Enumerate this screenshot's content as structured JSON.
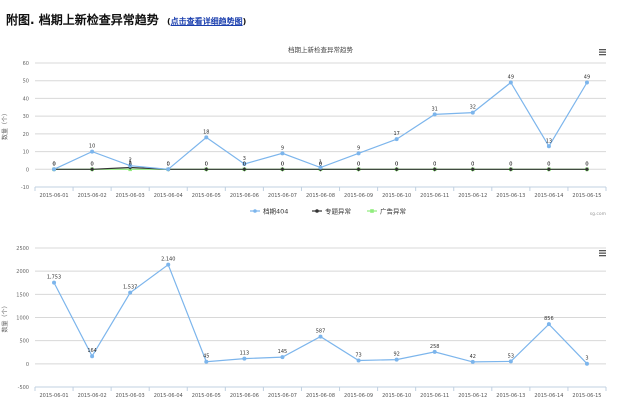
{
  "page": {
    "title": "附图. 档期上新检查异常趋势",
    "subtitle_prefix": "(",
    "subtitle_link": "点击查看详细趋势图",
    "subtitle_suffix": ")"
  },
  "chart_data": [
    {
      "type": "line",
      "title": "档期上新检查异常趋势",
      "ylabel": "数量（个）",
      "xlabel": "",
      "ylim": [
        -10,
        60
      ],
      "yticks": [
        -10,
        0,
        10,
        20,
        30,
        40,
        50,
        60
      ],
      "grid": true,
      "legend_position": "bottom-center",
      "categories": [
        "2015-06-01",
        "2015-06-02",
        "2015-06-03",
        "2015-06-04",
        "2015-06-05",
        "2015-06-06",
        "2015-06-07",
        "2015-06-08",
        "2015-06-09",
        "2015-06-10",
        "2015-06-11",
        "2015-06-12",
        "2015-06-13",
        "2015-06-14",
        "2015-06-15"
      ],
      "series": [
        {
          "name": "档期404",
          "color": "#7cb5ec",
          "values": [
            0,
            10,
            2,
            0,
            18,
            3,
            9,
            1,
            9,
            17,
            31,
            32,
            49,
            13,
            49
          ]
        },
        {
          "name": "专题异常",
          "color": "#333333",
          "values": [
            0,
            0,
            1,
            0,
            0,
            0,
            0,
            0,
            0,
            0,
            0,
            0,
            0,
            0,
            0
          ]
        },
        {
          "name": "广告异常",
          "color": "#90ed7d",
          "values": [
            0,
            0,
            0,
            0,
            0,
            0,
            0,
            0,
            0,
            0,
            0,
            0,
            0,
            0,
            0
          ]
        }
      ],
      "data_labels": [
        "0",
        "10",
        "2",
        "0",
        "18",
        "3",
        "9",
        "1",
        "9",
        "17",
        "31",
        "32",
        "49",
        "13",
        "49"
      ],
      "credit": "sg.com"
    },
    {
      "type": "line",
      "title": "",
      "ylabel": "数量（个）",
      "xlabel": "",
      "ylim": [
        -500,
        2500
      ],
      "yticks": [
        -500,
        0,
        500,
        1000,
        1500,
        2000,
        2500
      ],
      "grid": true,
      "categories": [
        "2015-06-01",
        "2015-06-02",
        "2015-06-03",
        "2015-06-04",
        "2015-06-05",
        "2015-06-06",
        "2015-06-07",
        "2015-06-08",
        "2015-06-09",
        "2015-06-10",
        "2015-06-11",
        "2015-06-12",
        "2015-06-13",
        "2015-06-14",
        "2015-06-15"
      ],
      "series": [
        {
          "color": "#7cb5ec",
          "values": [
            1753,
            164,
            1537,
            2140,
            45,
            113,
            145,
            587,
            73,
            92,
            258,
            42,
            53,
            856,
            3
          ]
        }
      ],
      "data_labels": [
        "1,753",
        "164",
        "1,537",
        "2,140",
        "45",
        "113",
        "145",
        "587",
        "73",
        "92",
        "258",
        "42",
        "53",
        "856",
        "3"
      ]
    }
  ]
}
